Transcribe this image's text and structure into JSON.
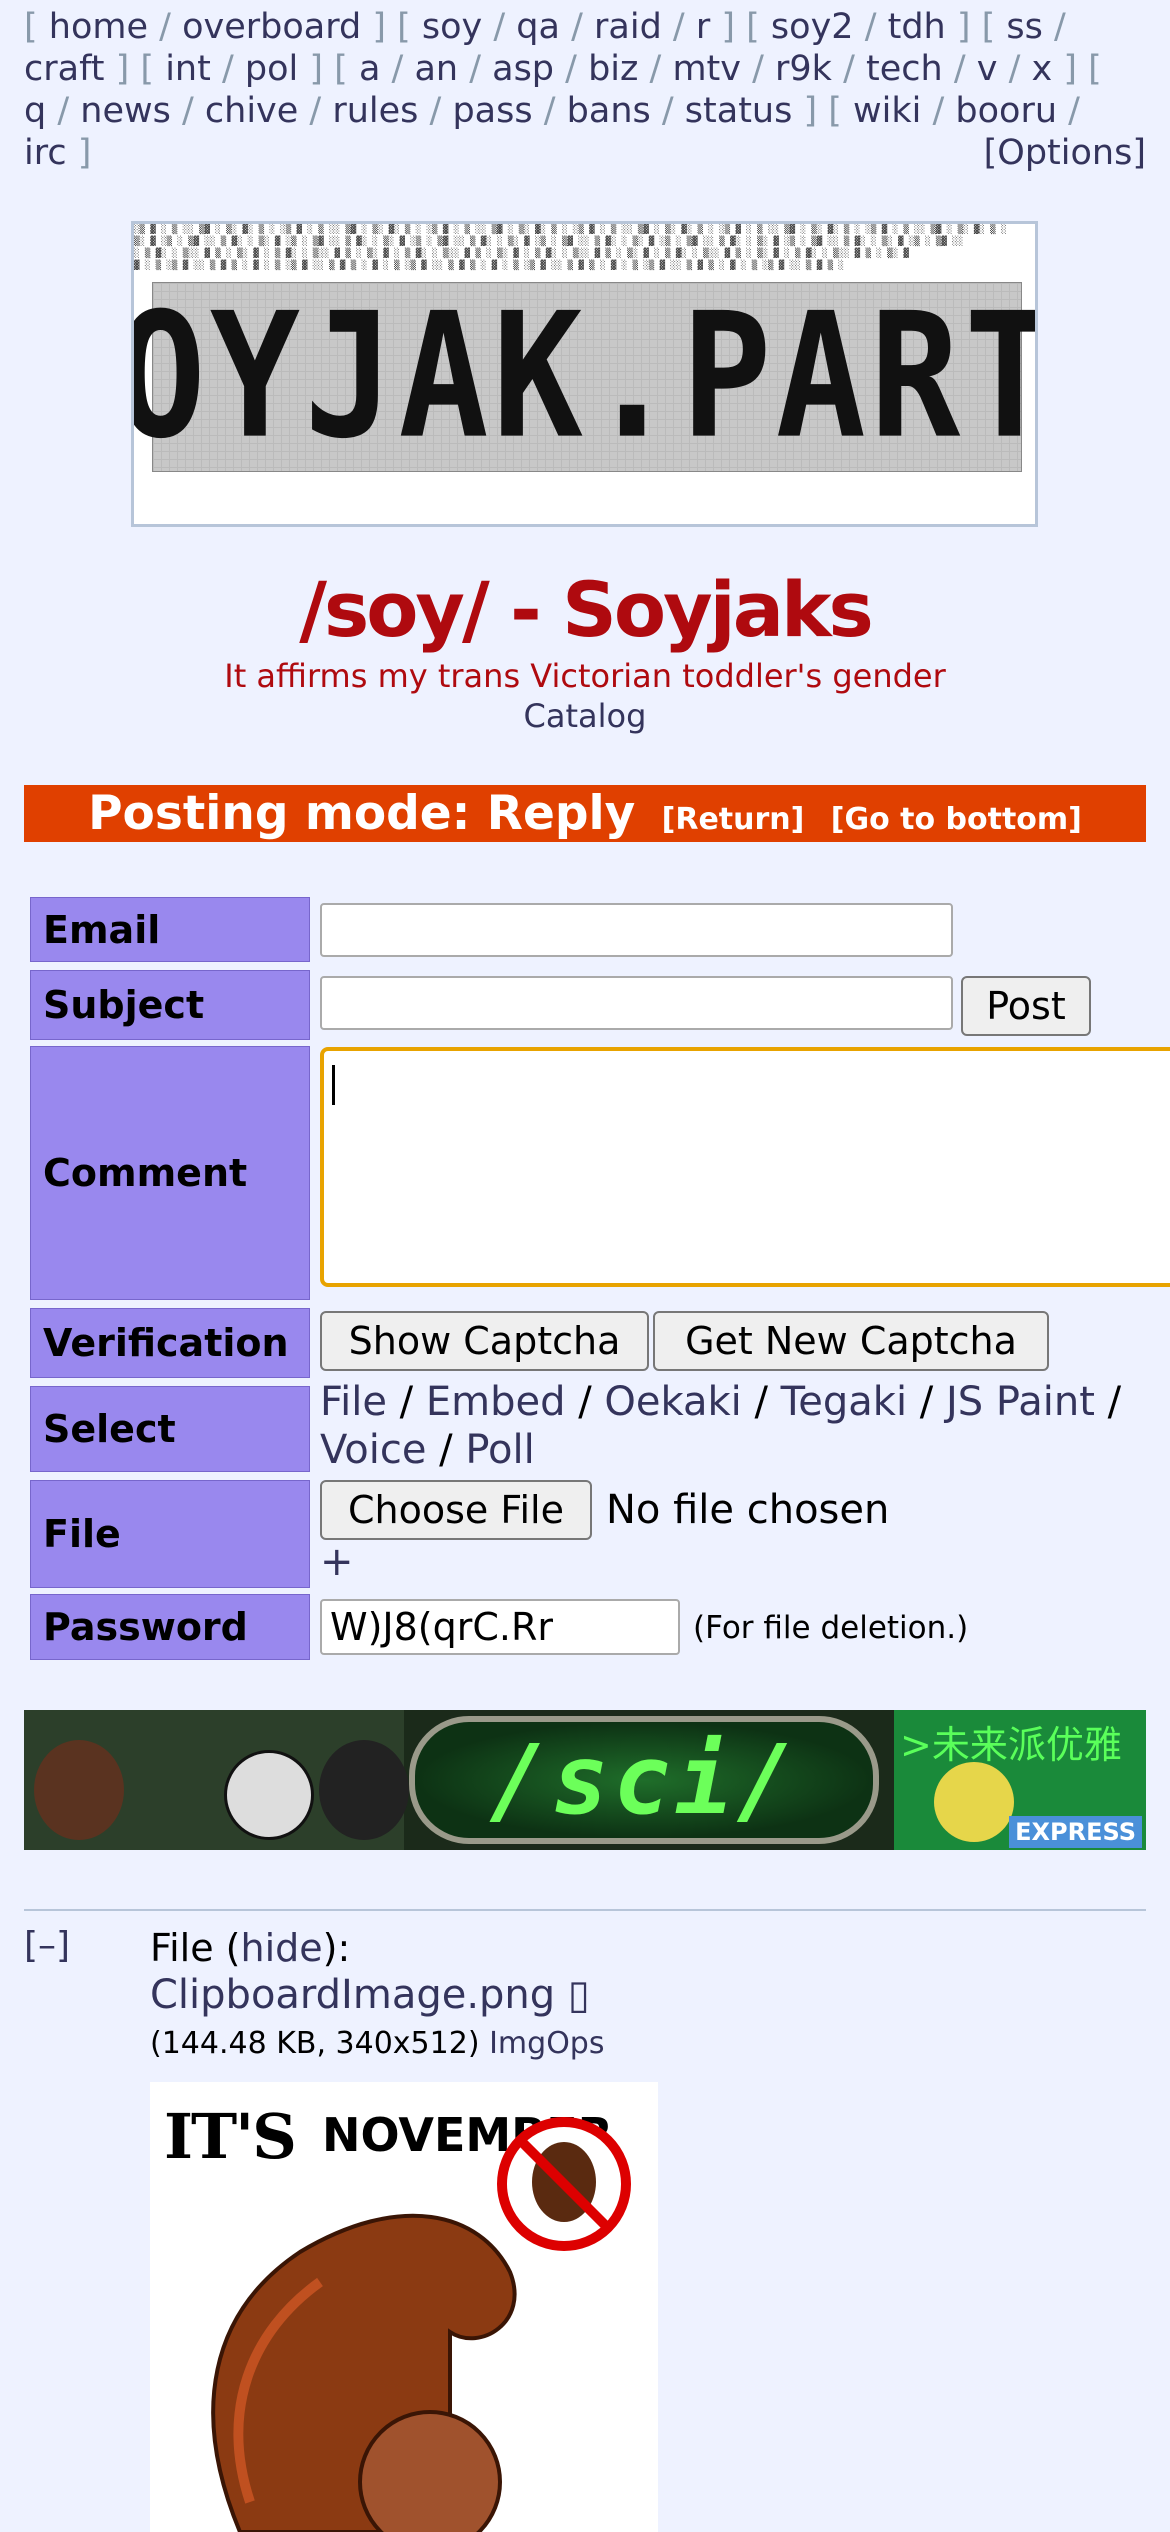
{
  "nav": {
    "groups": [
      [
        "home",
        "overboard"
      ],
      [
        "soy",
        "qa",
        "raid",
        "r"
      ],
      [
        "soy2",
        "tdh"
      ],
      [
        "ss",
        "craft"
      ],
      [
        "int",
        "pol"
      ],
      [
        "a",
        "an",
        "asp",
        "biz",
        "mtv",
        "r9k",
        "tech",
        "v",
        "x"
      ],
      [
        "q",
        "news",
        "chive",
        "rules",
        "pass",
        "bans",
        "status"
      ],
      [
        "wiki",
        "booru",
        "irc"
      ]
    ],
    "options_label": "[Options]"
  },
  "banner": {
    "logo_text": "SOYJAK.PARTY"
  },
  "board": {
    "title": "/soy/ - Soyjaks",
    "subtitle": "It affirms my trans Victorian toddler's gender",
    "catalog_label": "Catalog"
  },
  "posting_mode": {
    "text": "Posting mode: Reply",
    "return_label": "[Return]",
    "bottom_label": "[Go to bottom]"
  },
  "form": {
    "email_label": "Email",
    "subject_label": "Subject",
    "post_button": "Post",
    "comment_label": "Comment",
    "verification_label": "Verification",
    "show_captcha": "Show Captcha",
    "new_captcha": "Get New Captcha",
    "select_label": "Select",
    "select_options": [
      "File",
      "Embed",
      "Oekaki",
      "Tegaki",
      "JS Paint",
      "Voice",
      "Poll"
    ],
    "file_label": "File",
    "choose_file": "Choose File",
    "no_file": "No file chosen",
    "plus": "+",
    "password_label": "Password",
    "password_value": "W)J8(qrC.Rr",
    "password_note": "(For file deletion.)"
  },
  "ad_banner": {
    "board_text": "/sci/",
    "jp_text": ">未来派优雅",
    "corner_text": "EXPRESS"
  },
  "post": {
    "collapse": "[–]",
    "file_prefix": "File (",
    "hide_label": "hide",
    "file_suffix": "):",
    "filename": "ClipboardImage.png",
    "filename_icon": "▯",
    "meta": "(144.48 KB, 340x512)",
    "imgops": "ImgOps",
    "image_text_1": "IT'S",
    "image_text_2": "NOVEMBER"
  },
  "colors": {
    "background": "#eef2ff",
    "title_red": "#af0a0f",
    "link": "#34345c",
    "form_label": "#9988ee",
    "posting_mode": "#e04000",
    "comment_focus": "#e8a300"
  }
}
